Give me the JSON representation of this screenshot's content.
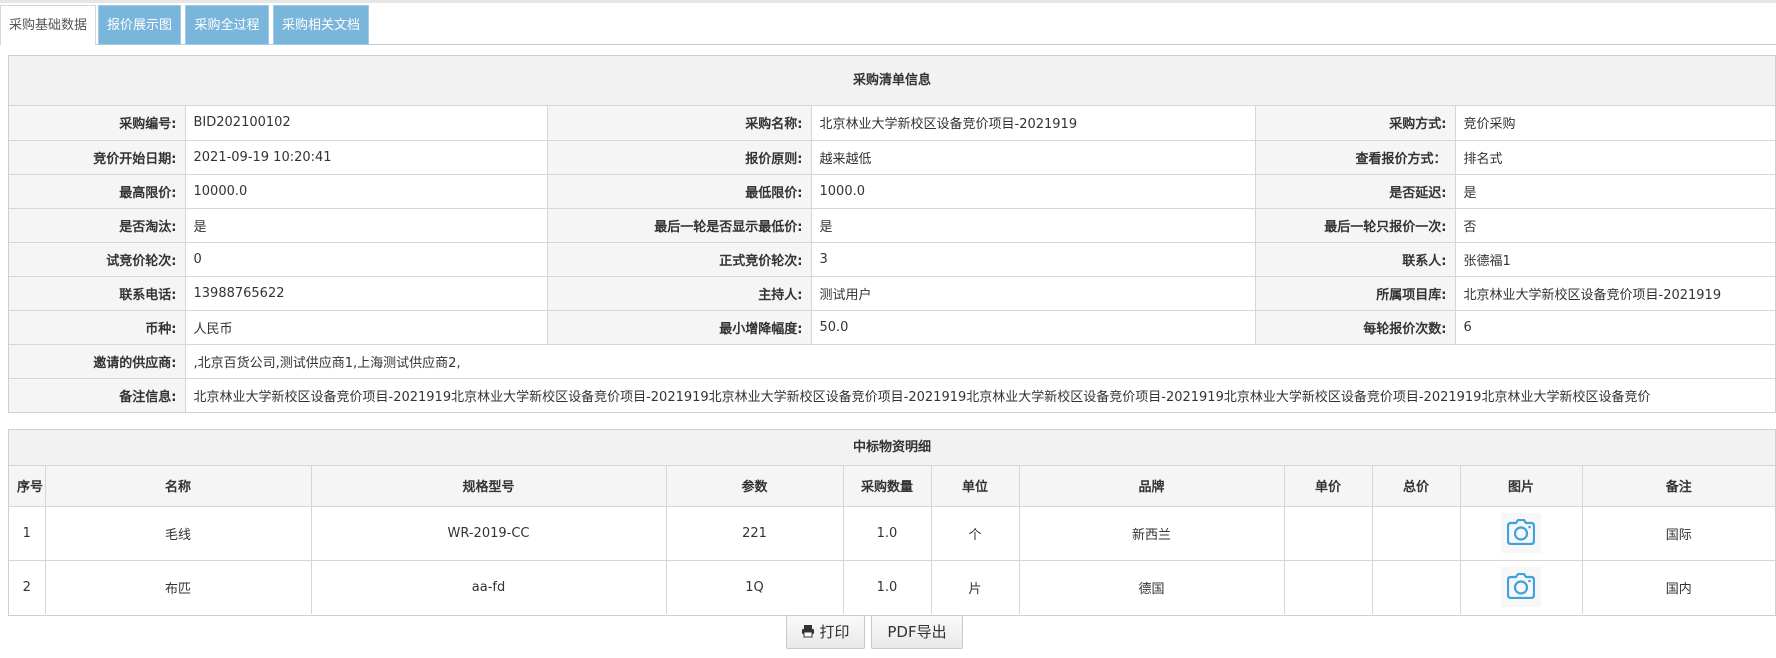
{
  "tabs": [
    {
      "label": "采购基础数据",
      "active": true
    },
    {
      "label": "报价展示图",
      "active": false
    },
    {
      "label": "采购全过程",
      "active": false
    },
    {
      "label": "采购相关文档",
      "active": false
    }
  ],
  "info": {
    "title": "采购清单信息",
    "rows": [
      [
        {
          "label": "采购编号:",
          "value": "BID202100102"
        },
        {
          "label": "采购名称:",
          "value": "北京林业大学新校区设备竞价项目-2021919"
        },
        {
          "label": "采购方式:",
          "value": "竞价采购"
        }
      ],
      [
        {
          "label": "竞价开始日期:",
          "value": "2021-09-19 10:20:41"
        },
        {
          "label": "报价原则:",
          "value": "越来越低"
        },
        {
          "label": "查看报价方式：",
          "value": "排名式"
        }
      ],
      [
        {
          "label": "最高限价:",
          "value": "10000.0"
        },
        {
          "label": "最低限价:",
          "value": "1000.0"
        },
        {
          "label": "是否延迟:",
          "value": "是"
        }
      ],
      [
        {
          "label": "是否淘汰:",
          "value": "是"
        },
        {
          "label": "最后一轮是否显示最低价:",
          "value": "是"
        },
        {
          "label": "最后一轮只报价一次:",
          "value": "否"
        }
      ],
      [
        {
          "label": "试竞价轮次:",
          "value": "0"
        },
        {
          "label": "正式竞价轮次:",
          "value": "3"
        },
        {
          "label": "联系人:",
          "value": "张德福1"
        }
      ],
      [
        {
          "label": "联系电话:",
          "value": "13988765622"
        },
        {
          "label": "主持人:",
          "value": "测试用户"
        },
        {
          "label": "所属项目库:",
          "value": "北京林业大学新校区设备竞价项目-2021919"
        }
      ],
      [
        {
          "label": "币种:",
          "value": "人民币"
        },
        {
          "label": "最小增降幅度:",
          "value": "50.0"
        },
        {
          "label": "每轮报价次数:",
          "value": "6"
        }
      ]
    ],
    "suppliers": {
      "label": "邀请的供应商:",
      "value": ",北京百货公司,测试供应商1,上海测试供应商2,"
    },
    "remarks": {
      "label": "备注信息:",
      "value": "北京林业大学新校区设备竞价项目-2021919北京林业大学新校区设备竞价项目-2021919北京林业大学新校区设备竞价项目-2021919北京林业大学新校区设备竞价项目-2021919北京林业大学新校区设备竞价项目-2021919北京林业大学新校区设备竞价"
    }
  },
  "detail": {
    "title": "中标物资明细",
    "columns": [
      "序号",
      "名称",
      "规格型号",
      "参数",
      "采购数量",
      "单位",
      "品牌",
      "单价",
      "总价",
      "图片",
      "备注"
    ],
    "rows": [
      [
        "1",
        "毛线",
        "WR-2019-CC",
        "221",
        "1.0",
        "个",
        "新西兰",
        "",
        "",
        "",
        "国际"
      ],
      [
        "2",
        "布匹",
        "aa-fd",
        "1Q",
        "1.0",
        "片",
        "德国",
        "",
        "",
        "",
        "国内"
      ]
    ]
  },
  "buttons": {
    "print": "打印",
    "pdf": "PDF导出"
  },
  "colors": {
    "tab_active_bg": "#ffffff",
    "tab_inactive_bg": "#7ab5db",
    "camera_icon": "#3ea3dc"
  }
}
